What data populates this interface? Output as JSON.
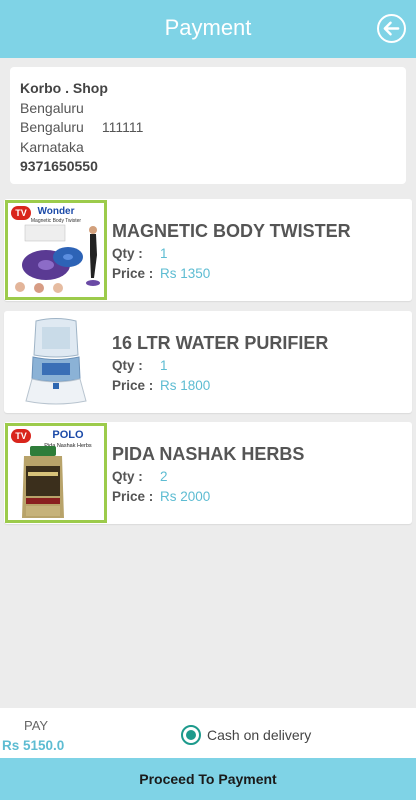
{
  "header": {
    "title": "Payment",
    "back_icon": "arrow-left-circle-icon"
  },
  "address": {
    "name": "Korbo . Shop",
    "line1": "Bengaluru",
    "city": "Bengaluru",
    "pin": "111111",
    "state": "Karnataka",
    "phone": "9371650550"
  },
  "products": [
    {
      "title": "MAGNETIC BODY TWISTER",
      "qty_label": "Qty :",
      "qty": "1",
      "price_label": "Price :",
      "price": "Rs 1350",
      "thumb_brand": "Wonder",
      "thumb_caption": "Magnetic Body Twister"
    },
    {
      "title": "16 LTR WATER PURIFIER",
      "qty_label": "Qty :",
      "qty": "1",
      "price_label": "Price :",
      "price": "Rs 1800"
    },
    {
      "title": "PIDA NASHAK HERBS",
      "qty_label": "Qty :",
      "qty": "2",
      "price_label": "Price :",
      "price": "Rs 2000",
      "thumb_brand": "POLO",
      "thumb_caption": "Pida Nashak Herbs"
    }
  ],
  "footer": {
    "pay_label": "PAY",
    "pay_amount": "Rs 5150.0",
    "payment_option": "Cash on delivery",
    "payment_selected": true
  },
  "proceed_label": "Proceed To Payment",
  "colors": {
    "accent": "#7fd3e6",
    "price": "#5dbcd2",
    "radio": "#1d9a8c",
    "thumb_border": "#9ccb4b"
  }
}
